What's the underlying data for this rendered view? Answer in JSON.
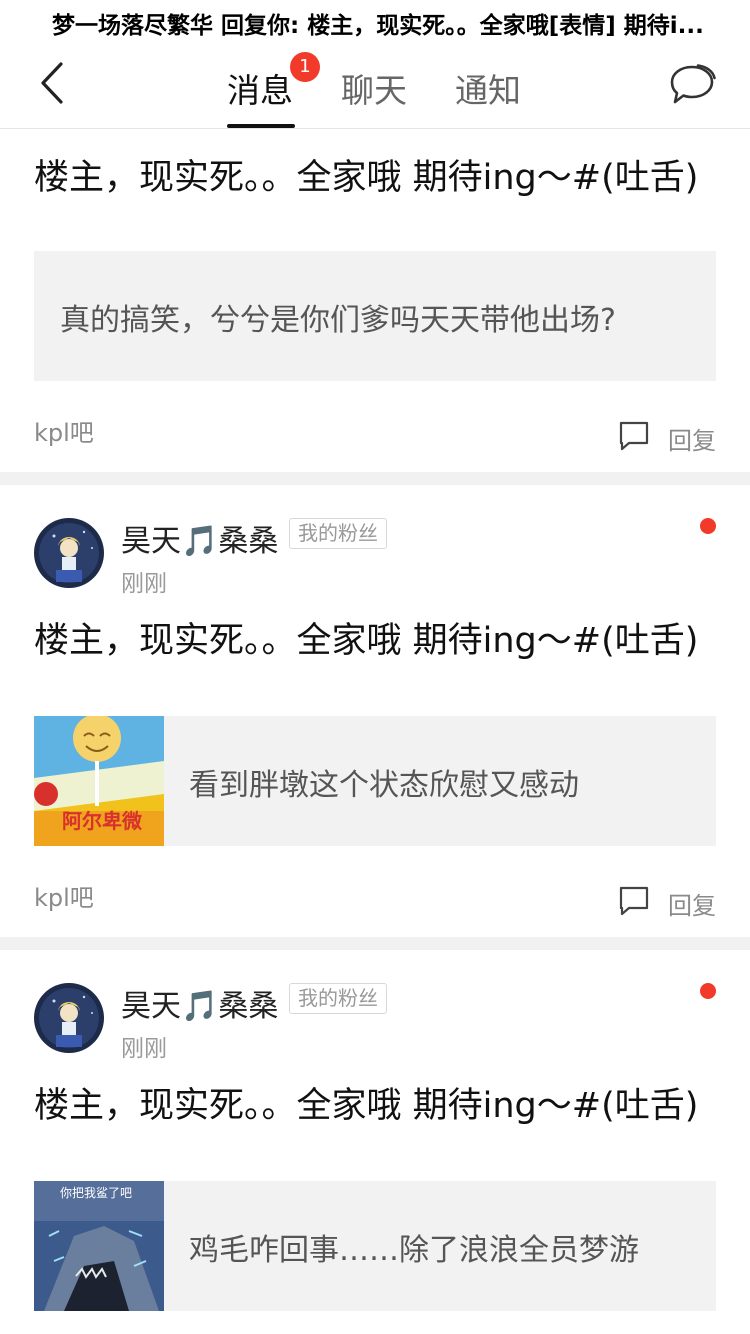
{
  "banner": {
    "text": "梦一场落尽繁华 回复你: 楼主，现实死。。全家哦[表情] 期待i..."
  },
  "navbar": {
    "tabs": [
      {
        "label": "消息",
        "active": true
      },
      {
        "label": "聊天",
        "active": false
      },
      {
        "label": "通知",
        "active": false
      }
    ],
    "badge_count": "1",
    "icons": {
      "back": "back-arrow-icon",
      "chat": "chat-bubble-icon"
    }
  },
  "cards": [
    {
      "comment": "楼主，现实死。。全家哦 期待ing～#(吐舌)",
      "quote": "真的搞笑，兮兮是你们爹吗天天带他出场?",
      "forum": "kpl吧",
      "reply_label": "回复"
    },
    {
      "username": "昊天🎵桑桑",
      "tag": "我的粉丝",
      "time": "刚刚",
      "comment": "楼主，现实死。。全家哦 期待ing～#(吐舌)",
      "quote": "看到胖墩这个状态欣慰又感动",
      "forum": "kpl吧",
      "reply_label": "回复"
    },
    {
      "username": "昊天🎵桑桑",
      "tag": "我的粉丝",
      "time": "刚刚",
      "comment": "楼主，现实死。。全家哦 期待ing～#(吐舌)",
      "quote": "鸡毛咋回事……除了浪浪全员梦游",
      "thumb_caption": "你把我鲨了吧"
    }
  ],
  "colors": {
    "accent_red": "#f23a2a",
    "quote_bg": "#f2f2f2",
    "divider": "#f1f1f1"
  }
}
